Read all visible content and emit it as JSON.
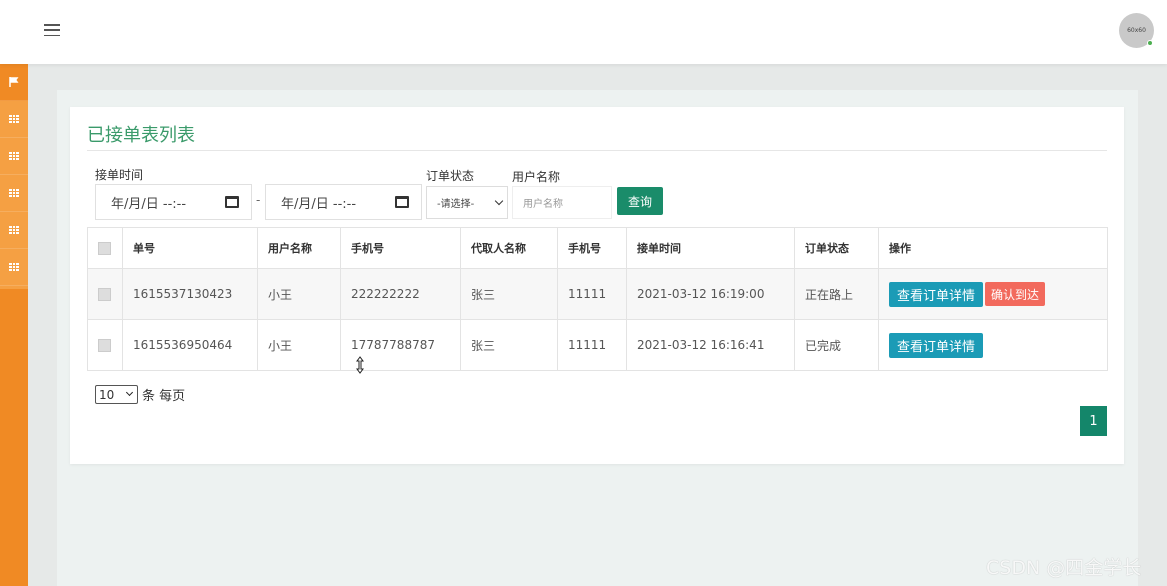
{
  "header": {
    "avatar_text": "60x60"
  },
  "sidebar": {
    "items": [
      "flag-icon",
      "grid-icon",
      "grid-icon",
      "grid-icon",
      "grid-icon",
      "grid-icon"
    ]
  },
  "card": {
    "title": "已接单表列表"
  },
  "filters": {
    "order_time_label": "接单时间",
    "date_placeholder": "年/月/日 --:--",
    "separator": "-",
    "status_label": "订单状态",
    "status_selected": "-请选择-",
    "username_label": "用户名称",
    "username_placeholder": "用户名称",
    "query_label": "查询"
  },
  "table": {
    "headers": [
      "单号",
      "用户名称",
      "手机号",
      "代取人名称",
      "手机号",
      "接单时间",
      "订单状态",
      "操作"
    ],
    "rows": [
      [
        "1615537130423",
        "小王",
        "222222222",
        "张三",
        "11111",
        "2021-03-12 16:19:00",
        "正在路上"
      ],
      [
        "1615536950464",
        "小王",
        "17787788787",
        "张三",
        "11111",
        "2021-03-12 16:16:41",
        "已完成"
      ]
    ],
    "detail_label": "查看订单详情",
    "arrive_label": "确认到达"
  },
  "pagination": {
    "per_page_value": "10",
    "per_page_text": "条 每页",
    "current_page": "1"
  },
  "watermark": "CSDN @四金学长",
  "colors": {
    "sidebar": "#f5a043",
    "title": "#3a9a6a",
    "primary": "#1a8c6a",
    "info": "#1b9bb6",
    "danger": "#f26a5d"
  }
}
